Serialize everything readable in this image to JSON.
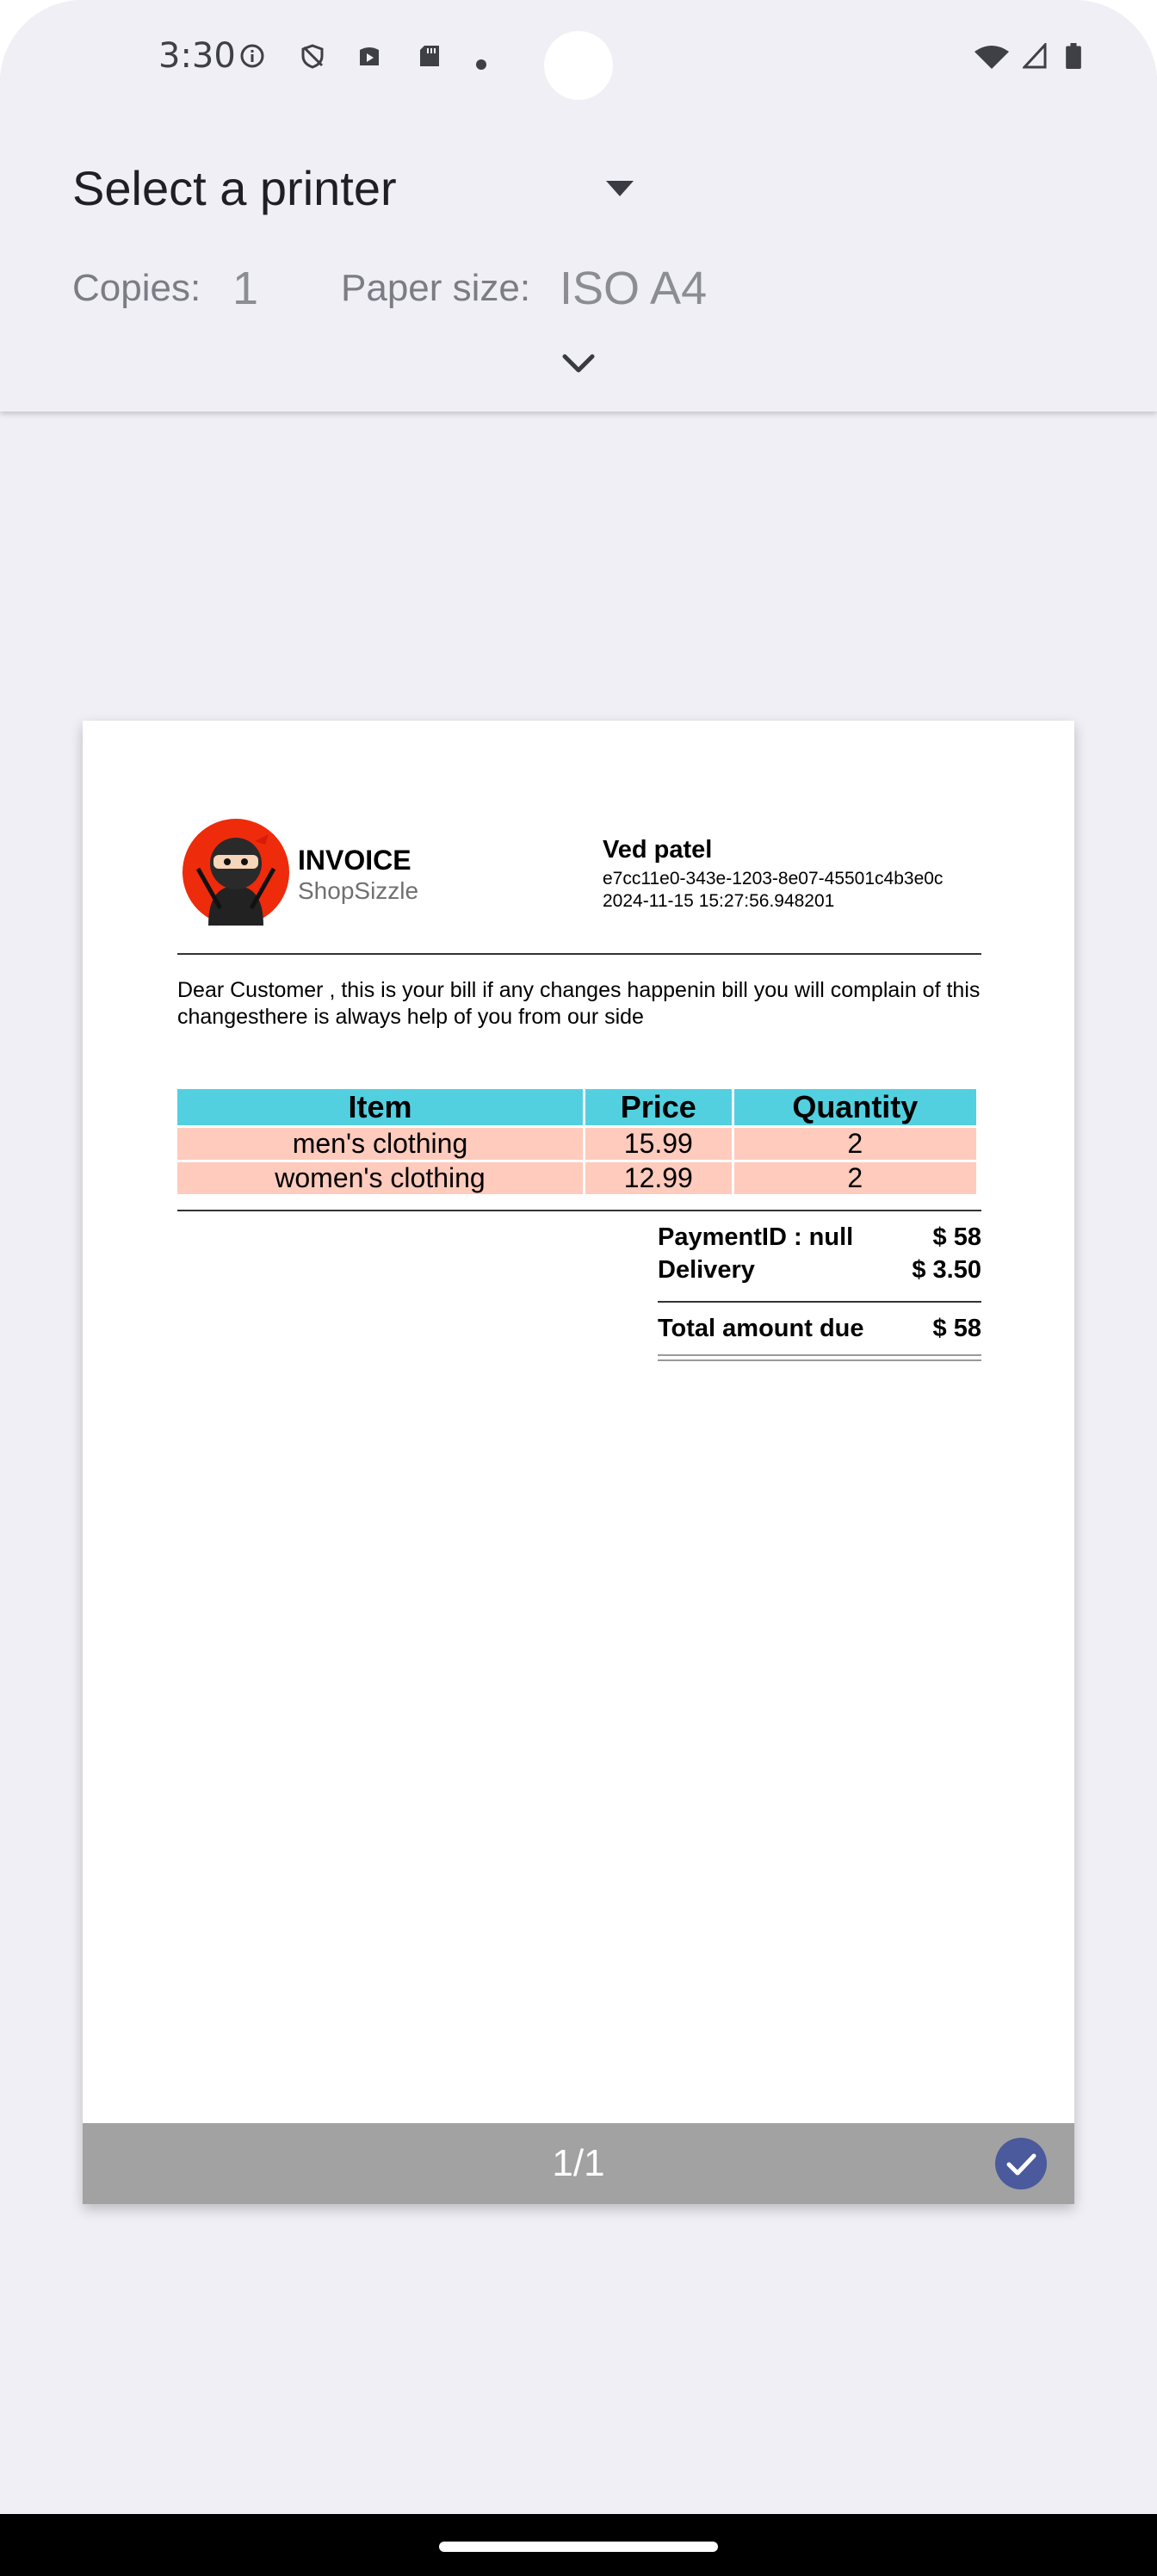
{
  "status_bar": {
    "time": "3:30"
  },
  "print_options": {
    "printer_label": "Select a printer",
    "copies_label": "Copies:",
    "copies_value": "1",
    "paper_size_label": "Paper size:",
    "paper_size_value": "ISO A4"
  },
  "invoice": {
    "title": "INVOICE",
    "brand": "ShopSizzle",
    "customer_name": "Ved patel",
    "order_id": "e7cc11e0-343e-1203-8e07-45501c4b3e0c",
    "date": "2024-11-15 15:27:56.948201",
    "message": "Dear Customer , this is your bill if any changes happenin bill you will complain of this changesthere is always help of you from our side",
    "columns": [
      "Item",
      "Price",
      "Quantity"
    ],
    "rows": [
      [
        "men's clothing",
        "15.99",
        "2"
      ],
      [
        "women's clothing",
        "12.99",
        "2"
      ]
    ],
    "payment_label": "PaymentID : null",
    "payment_value": "$ 58",
    "delivery_label": "Delivery",
    "delivery_value": "$ 3.50",
    "total_label": "Total amount due",
    "total_value": "$ 58"
  },
  "preview": {
    "page_indicator": "1/1"
  },
  "colors": {
    "table_header": "#52d0e0",
    "table_row": "#fecbbd",
    "check_badge": "#4a5a9c",
    "logo_bg": "#ee2b0b"
  }
}
